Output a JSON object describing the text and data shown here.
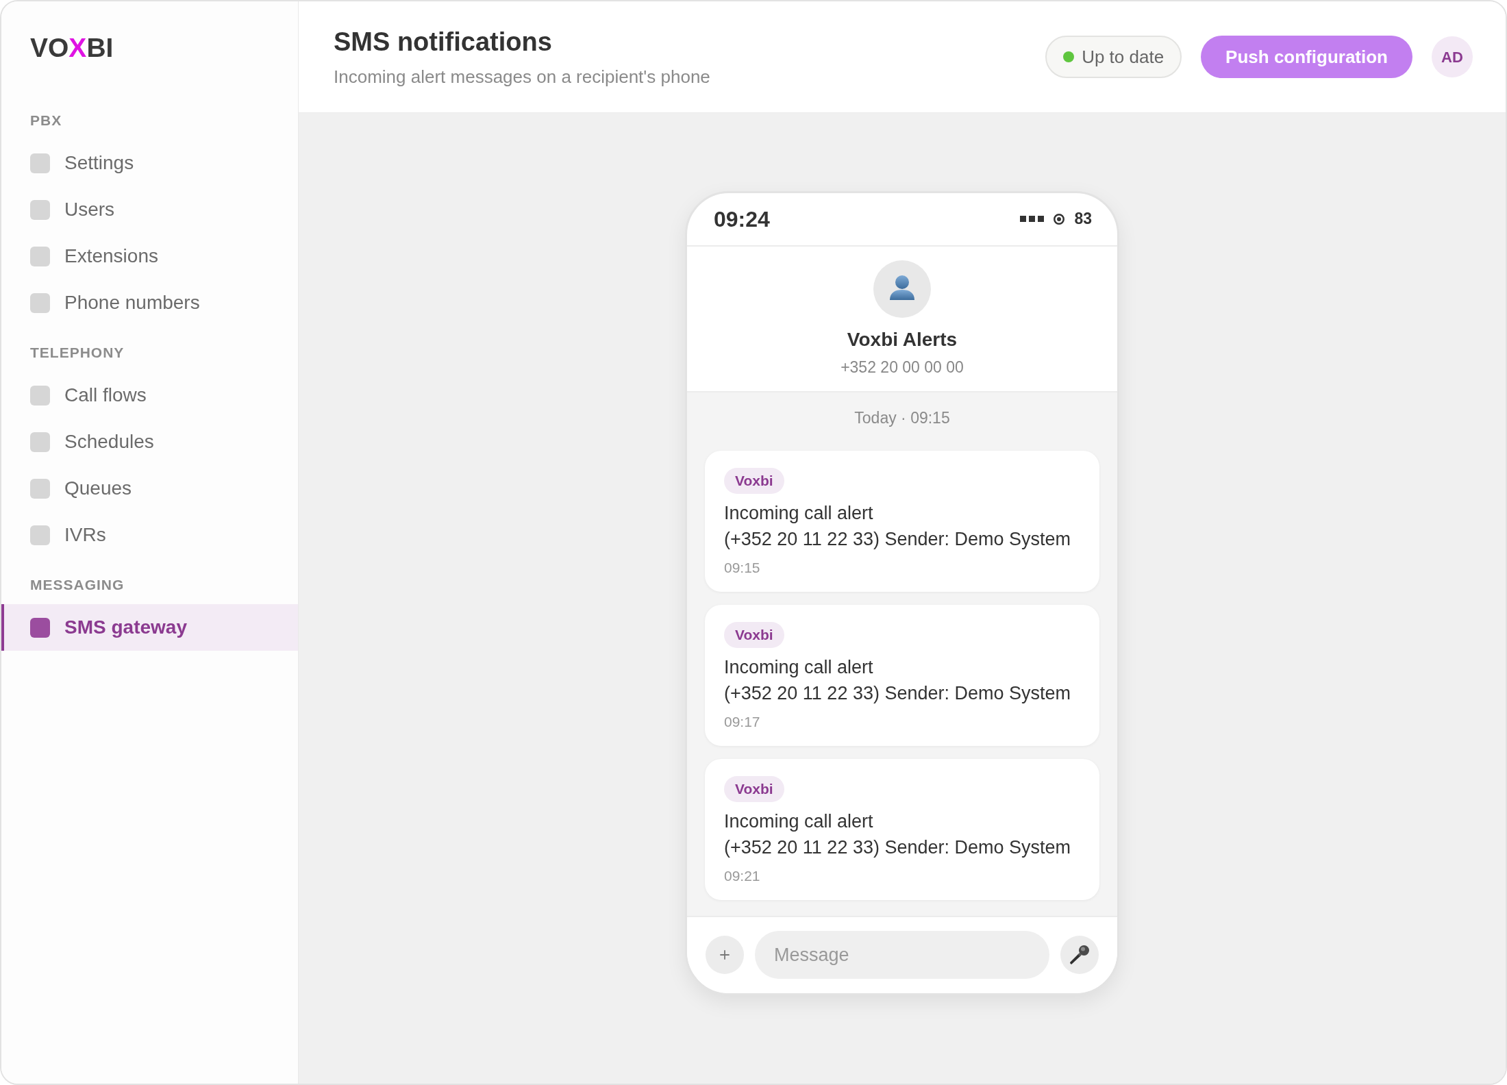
{
  "sidebar": {
    "logo": {
      "parts": [
        {
          "text": "VO",
          "accent": false
        },
        {
          "text": "X",
          "accent": true
        },
        {
          "text": "BI",
          "accent": false
        }
      ]
    },
    "sections": [
      {
        "label": "PBX",
        "items": [
          {
            "label": "Settings",
            "selected": false
          },
          {
            "label": "Users",
            "selected": false
          },
          {
            "label": "Extensions",
            "selected": false
          },
          {
            "label": "Phone numbers",
            "selected": false
          }
        ]
      },
      {
        "label": "TELEPHONY",
        "items": [
          {
            "label": "Call flows",
            "selected": false
          },
          {
            "label": "Schedules",
            "selected": false
          },
          {
            "label": "Queues",
            "selected": false
          },
          {
            "label": "IVRs",
            "selected": false
          }
        ]
      },
      {
        "label": "MESSAGING",
        "items": [
          {
            "label": "SMS gateway",
            "selected": true
          }
        ]
      }
    ]
  },
  "header": {
    "title": "SMS notifications",
    "subtitle": "Incoming alert messages on a recipient's phone",
    "status": {
      "label": "Up to date"
    },
    "primary_button": "Push configuration",
    "user": {
      "initials": "AD"
    }
  },
  "phone": {
    "status_bar": {
      "time": "09:24",
      "battery": "83"
    },
    "contact": {
      "name": "Voxbi Alerts",
      "number": "+352 20 00 00 00"
    },
    "day_separator": "Today · 09:15",
    "messages": [
      {
        "sender": "Voxbi",
        "text": "Incoming call alert\n(+352 20 11 22 33) Sender: Demo System",
        "time": "09:15"
      },
      {
        "sender": "Voxbi",
        "text": "Incoming call alert\n(+352 20 11 22 33) Sender: Demo System",
        "time": "09:17"
      },
      {
        "sender": "Voxbi",
        "text": "Incoming call alert\n(+352 20 11 22 33) Sender: Demo System",
        "time": "09:21"
      }
    ],
    "composer": {
      "placeholder": "Message"
    }
  }
}
